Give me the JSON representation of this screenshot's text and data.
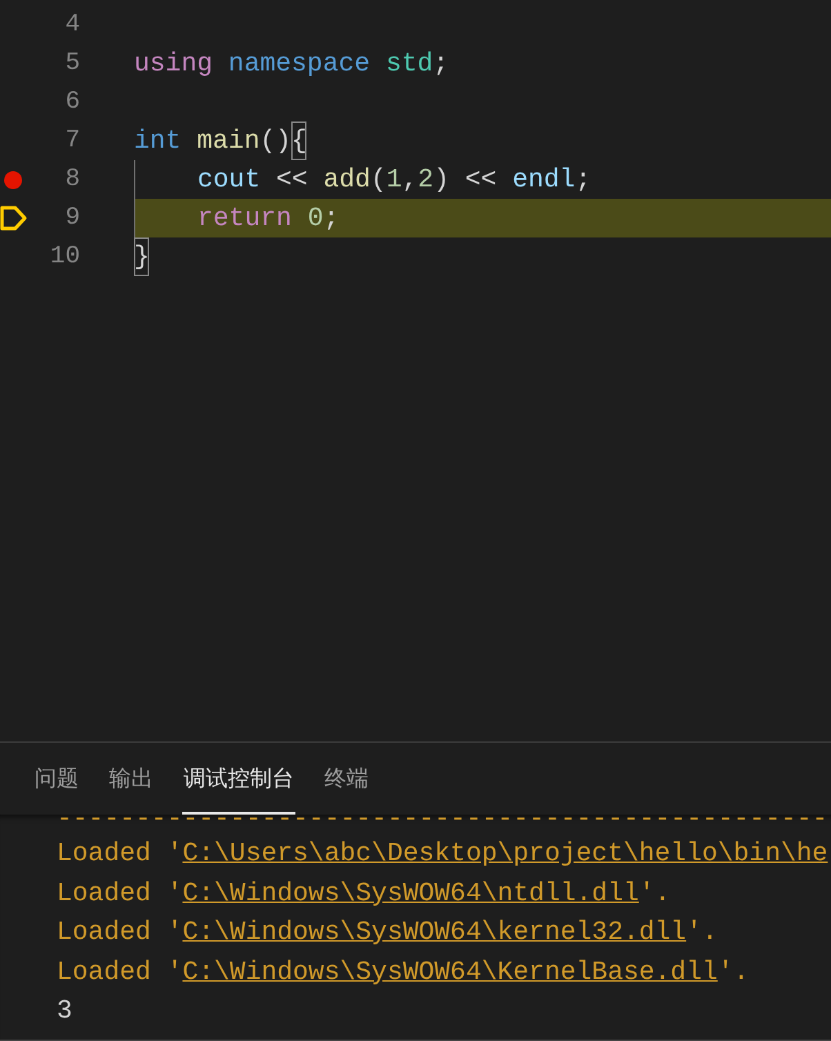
{
  "editor": {
    "lines": [
      {
        "number": "4",
        "breakpoint": false,
        "current": false,
        "indent": false
      },
      {
        "number": "5",
        "breakpoint": false,
        "current": false,
        "indent": false,
        "tokens": [
          {
            "kind": "keyword",
            "text": "using"
          },
          {
            "kind": "storage",
            "text": " namespace"
          },
          {
            "kind": "type",
            "text": " std"
          },
          {
            "kind": "plain",
            "text": ";"
          }
        ]
      },
      {
        "number": "6",
        "breakpoint": false,
        "current": false,
        "indent": false
      },
      {
        "number": "7",
        "breakpoint": false,
        "current": false,
        "indent": false,
        "tokens": [
          {
            "kind": "storage",
            "text": "int"
          },
          {
            "kind": "function",
            "text": " main"
          },
          {
            "kind": "plain",
            "text": "()"
          },
          {
            "kind": "bracket_match",
            "text": "{"
          }
        ]
      },
      {
        "number": "8",
        "breakpoint": true,
        "current": false,
        "indent": true,
        "tokens": [
          {
            "kind": "variable",
            "text": "cout"
          },
          {
            "kind": "plain",
            "text": " << "
          },
          {
            "kind": "function",
            "text": "add"
          },
          {
            "kind": "plain",
            "text": "("
          },
          {
            "kind": "number",
            "text": "1"
          },
          {
            "kind": "plain",
            "text": ","
          },
          {
            "kind": "number",
            "text": "2"
          },
          {
            "kind": "plain",
            "text": ") << "
          },
          {
            "kind": "variable",
            "text": "endl"
          },
          {
            "kind": "plain",
            "text": ";"
          }
        ]
      },
      {
        "number": "9",
        "breakpoint": false,
        "current": true,
        "indent": true,
        "tokens": [
          {
            "kind": "keyword",
            "text": "return"
          },
          {
            "kind": "number",
            "text": " 0"
          },
          {
            "kind": "plain",
            "text": ";"
          }
        ]
      },
      {
        "number": "10",
        "breakpoint": false,
        "current": false,
        "indent": false,
        "tokens": [
          {
            "kind": "bracket_match",
            "text": "}"
          }
        ]
      }
    ]
  },
  "panel": {
    "tabs": [
      {
        "label": "问题",
        "selected": false
      },
      {
        "label": "输出",
        "selected": false
      },
      {
        "label": "调试控制台",
        "selected": true
      },
      {
        "label": "终端",
        "selected": false
      }
    ],
    "console": [
      {
        "kind": "separator",
        "text": "-------------------------------------------------"
      },
      {
        "kind": "loaded",
        "prefix": "Loaded '",
        "path": "C:\\Users\\abc\\Desktop\\project\\hello\\bin\\he"
      },
      {
        "kind": "loaded",
        "prefix": "Loaded '",
        "path": "C:\\Windows\\SysWOW64\\ntdll.dll",
        "suffix": "'."
      },
      {
        "kind": "loaded",
        "prefix": "Loaded '",
        "path": "C:\\Windows\\SysWOW64\\kernel32.dll",
        "suffix": "'."
      },
      {
        "kind": "loaded",
        "prefix": "Loaded '",
        "path": "C:\\Windows\\SysWOW64\\KernelBase.dll",
        "suffix": "'."
      },
      {
        "kind": "result",
        "text": "3"
      }
    ]
  }
}
